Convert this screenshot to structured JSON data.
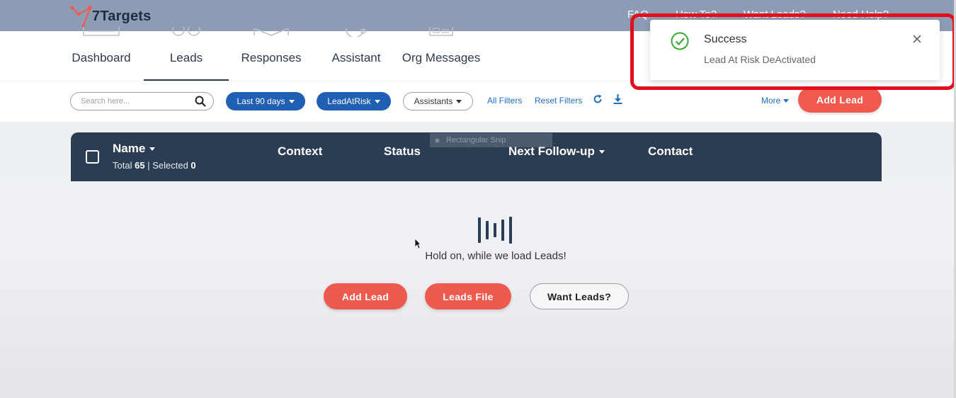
{
  "app": {
    "logo_text": "7Targets",
    "brand_color": "#f05a4f",
    "accent_blue": "#1f5fb4",
    "header_dark": "#2b3d53"
  },
  "top_links": [
    "FAQ",
    "How To?",
    "Want Leads?",
    "Need Help?"
  ],
  "nav": {
    "items": [
      {
        "label": "Dashboard",
        "icon": "dashboard-icon"
      },
      {
        "label": "Leads",
        "icon": "leads-icon",
        "active": true
      },
      {
        "label": "Responses",
        "icon": "mail-icon"
      },
      {
        "label": "Assistant",
        "icon": "assistant-icon"
      },
      {
        "label": "Org Messages",
        "icon": "org-messages-icon"
      }
    ]
  },
  "filters": {
    "search_placeholder": "Search here...",
    "date_range": "Last 90 days",
    "lead_filter": "LeadAtRisk",
    "assistants": "Assistants",
    "all_filters": "All Filters",
    "reset_filters": "Reset Filters",
    "more": "More",
    "add_lead": "Add Lead"
  },
  "table": {
    "columns": {
      "name": "Name",
      "context": "Context",
      "status": "Status",
      "next_followup": "Next Follow-up",
      "contact": "Contact"
    },
    "total_label": "Total",
    "total": "65",
    "selected_label": "Selected",
    "selected": "0",
    "ghost_tooltip": "Rectangular Snip"
  },
  "loading": {
    "text": "Hold on, while we load Leads!",
    "add_lead": "Add Lead",
    "leads_file": "Leads File",
    "want_leads": "Want Leads?"
  },
  "toast": {
    "title": "Success",
    "message": "Lead At Risk DeActivated",
    "icon": "check-circle-icon",
    "highlight_color": "#e3101c"
  }
}
